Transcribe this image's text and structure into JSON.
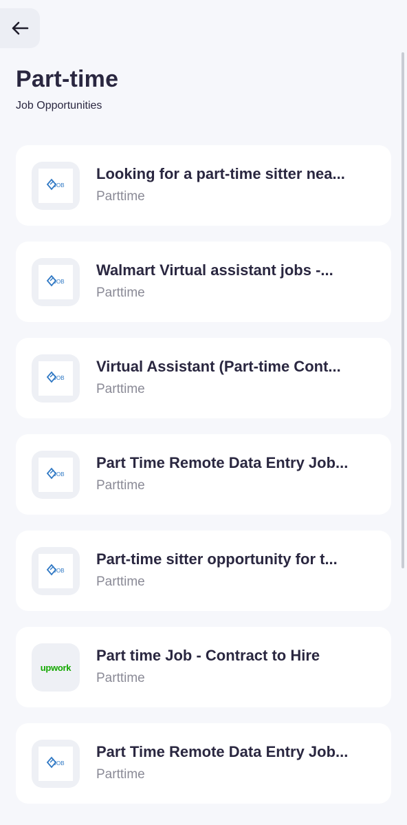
{
  "header": {
    "back_icon": "arrow-left-icon",
    "title": "Part-time",
    "subtitle": "Job Opportunities"
  },
  "jobs": [
    {
      "title": "Looking for a part-time sitter nea...",
      "type": "Parttime",
      "logo": "job-logo-icon"
    },
    {
      "title": "Walmart Virtual assistant jobs -...",
      "type": "Parttime",
      "logo": "job-logo-icon"
    },
    {
      "title": "Virtual Assistant (Part-time Cont...",
      "type": "Parttime",
      "logo": "job-logo-icon"
    },
    {
      "title": "Part Time Remote Data Entry Job...",
      "type": "Parttime",
      "logo": "job-logo-icon"
    },
    {
      "title": "Part-time sitter opportunity for t...",
      "type": "Parttime",
      "logo": "job-logo-icon"
    },
    {
      "title": "Part time Job - Contract to Hire",
      "type": "Parttime",
      "logo": "upwork-logo",
      "logo_text": "upwork"
    },
    {
      "title": "Part Time Remote Data Entry Job...",
      "type": "Parttime",
      "logo": "job-logo-icon"
    }
  ],
  "colors": {
    "background": "#f6f7fb",
    "card": "#ffffff",
    "title_text": "#2a2740",
    "muted_text": "#8a8a96",
    "job_logo_blue": "#2f78c4",
    "upwork_green": "#14a800"
  }
}
